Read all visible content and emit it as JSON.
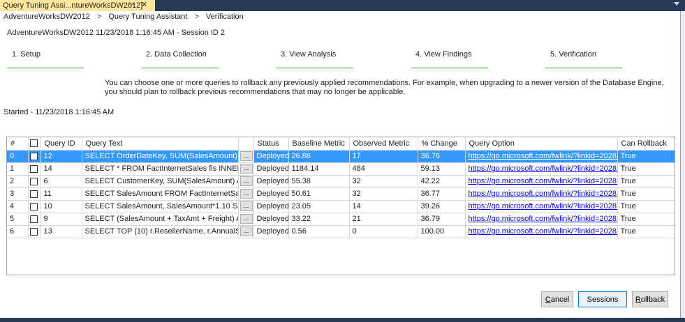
{
  "tab": {
    "title": "Query Tuning Assi...ntureWorksDW2012]",
    "pin_glyph": "⊸",
    "close_glyph": "✕"
  },
  "breadcrumb": {
    "items": [
      "AdventureWorksDW2012",
      "Query Tuning Assistant",
      "Verification"
    ],
    "separator": ">"
  },
  "session_line": "AdventureWorksDW2012 11/23/2018 1:16:45 AM - Session ID 2",
  "steps": [
    {
      "label": "1. Setup"
    },
    {
      "label": "2. Data Collection"
    },
    {
      "label": "3. View Analysis"
    },
    {
      "label": "4. View Findings"
    },
    {
      "label": "5. Verification"
    }
  ],
  "description": "You can choose one or more queries to rollback any previously applied recommendations. For example, when upgrading to a newer version of the Database Engine, you should plan to rollback previous recommendations that may no longer be applicable.",
  "started": "Started - 11/23/2018 1:16:45 AM",
  "grid": {
    "columns": [
      "#",
      "",
      "Query ID",
      "Query Text",
      "",
      "Status",
      "Baseline Metric",
      "Observed Metric",
      "% Change",
      "Query Option",
      "Can Rollback"
    ],
    "ellipsis": "...",
    "rows": [
      {
        "idx": "0",
        "query_id": "12",
        "query_text": "SELECT OrderDateKey, SUM(SalesAmount) AS Tot...",
        "status": "Deployed",
        "baseline": "26.88",
        "observed": "17",
        "change": "36.76",
        "option": "https://go.microsoft.com/fwlink/?linkid=2028175",
        "rollback": "True"
      },
      {
        "idx": "1",
        "query_id": "14",
        "query_text": "SELECT * FROM FactInternetSales fis INNER JOIN ...",
        "status": "Deployed",
        "baseline": "1184.14",
        "observed": "484",
        "change": "59.13",
        "option": "https://go.microsoft.com/fwlink/?linkid=2028217",
        "rollback": "True"
      },
      {
        "idx": "2",
        "query_id": "6",
        "query_text": "SELECT CustomerKey, SUM(SalesAmount) AS sas ...",
        "status": "Deployed",
        "baseline": "55.38",
        "observed": "32",
        "change": "42.22",
        "option": "https://go.microsoft.com/fwlink/?linkid=2028175",
        "rollback": "True"
      },
      {
        "idx": "3",
        "query_id": "11",
        "query_text": "SELECT SalesAmount FROM FactInternetSales GR...",
        "status": "Deployed",
        "baseline": "50.61",
        "observed": "32",
        "change": "36.77",
        "option": "https://go.microsoft.com/fwlink/?linkid=2028175",
        "rollback": "True"
      },
      {
        "idx": "4",
        "query_id": "10",
        "query_text": "SELECT SalesAmount, SalesAmount*1.10 SalesTax...",
        "status": "Deployed",
        "baseline": "23.05",
        "observed": "14",
        "change": "39.26",
        "option": "https://go.microsoft.com/fwlink/?linkid=2028175",
        "rollback": "True"
      },
      {
        "idx": "5",
        "query_id": "9",
        "query_text": "SELECT (SalesAmount + TaxAmt + Freight) AS To...",
        "status": "Deployed",
        "baseline": "33.22",
        "observed": "21",
        "change": "36.79",
        "option": "https://go.microsoft.com/fwlink/?linkid=2028175",
        "rollback": "True"
      },
      {
        "idx": "6",
        "query_id": "13",
        "query_text": "SELECT TOP (10) r.ResellerName, r.AnnualSales  F...",
        "status": "Deployed",
        "baseline": "0.56",
        "observed": "0",
        "change": "100.00",
        "option": "https://go.microsoft.com/fwlink/?linkid=2028175",
        "rollback": "True"
      }
    ]
  },
  "buttons": {
    "cancel_mnemonic": "C",
    "cancel_rest": "ancel",
    "sessions": "Sessions",
    "rollback_mnemonic": "R",
    "rollback_rest": "ollback"
  },
  "colors": {
    "accent_tab": "#ffe79d",
    "selection": "#3399ff",
    "step_line": "#3aa035",
    "chrome": "#2b3a57"
  }
}
